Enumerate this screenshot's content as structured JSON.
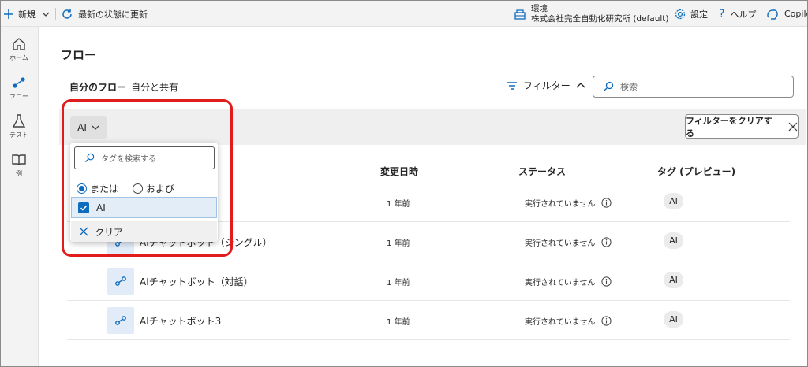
{
  "topbar": {
    "new_label": "新規",
    "refresh_label": "最新の状態に更新",
    "env_label": "環境",
    "env_name": "株式会社完全自動化研究所 (default)",
    "settings_label": "設定",
    "help_label": "ヘルプ",
    "copilot_label": "Copilo"
  },
  "sidebar": {
    "items": [
      {
        "label": "ホーム",
        "icon": "home-icon"
      },
      {
        "label": "フロー",
        "icon": "flow-icon"
      },
      {
        "label": "テスト",
        "icon": "flask-icon"
      },
      {
        "label": "例",
        "icon": "book-icon"
      }
    ]
  },
  "main": {
    "title": "フロー",
    "tabs": [
      {
        "label": "自分のフロー"
      },
      {
        "label": "自分と共有"
      }
    ],
    "filter_label": "フィルター",
    "search_placeholder": "検索",
    "filter_chip_label": "AI",
    "clear_filter_label": "フィルターをクリアする",
    "columns": {
      "modified": "変更日時",
      "status": "ステータス",
      "tags": "タグ (プレビュー)"
    },
    "rows": [
      {
        "name": "AIチャットボット（シングル）",
        "modified": "1 年前",
        "status": "実行されていません",
        "tag": "AI"
      },
      {
        "name": "AIチャットボット（対話）",
        "modified": "1 年前",
        "status": "実行されていません",
        "tag": "AI"
      },
      {
        "name": "AIチャットボット3",
        "modified": "1 年前",
        "status": "実行されていません",
        "tag": "AI"
      }
    ],
    "first_row": {
      "modified": "1 年前",
      "status": "実行されていません",
      "tag": "AI"
    }
  },
  "dropdown": {
    "search_placeholder": "タグを検索する",
    "radio_or": "または",
    "radio_and": "および",
    "option_ai": "AI",
    "clear_label": "クリア"
  },
  "colors": {
    "accent": "#0f6cbd",
    "highlight": "#e21b1b"
  }
}
